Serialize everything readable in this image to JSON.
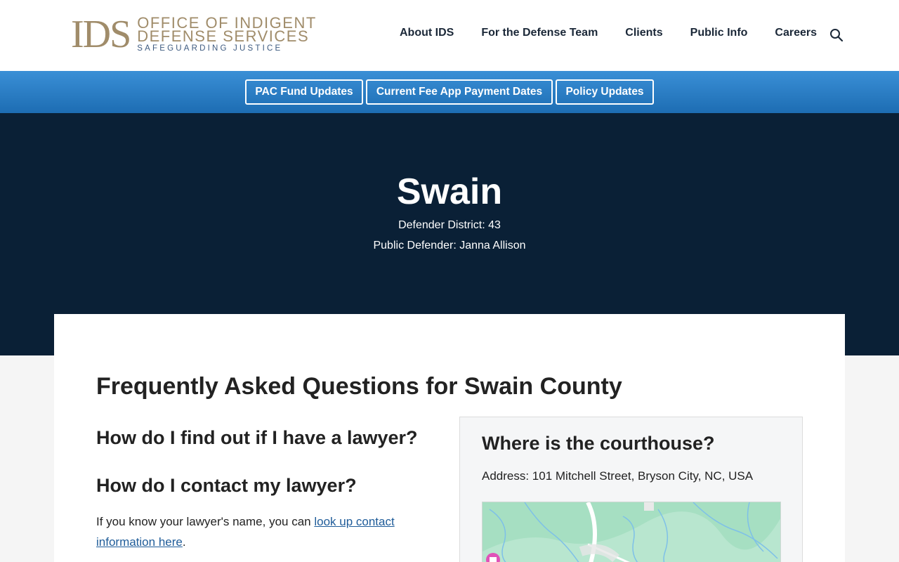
{
  "logo": {
    "mark": "IDS",
    "line1": "OFFICE OF INDIGENT",
    "line2": "DEFENSE SERVICES",
    "tagline": "SAFEGUARDING JUSTICE"
  },
  "nav": {
    "items": [
      "About IDS",
      "For the Defense Team",
      "Clients",
      "Public Info",
      "Careers"
    ],
    "search_icon": "search-icon"
  },
  "quickbar": {
    "buttons": [
      "PAC Fund Updates",
      "Current Fee App Payment Dates",
      "Policy Updates"
    ]
  },
  "hero": {
    "title": "Swain",
    "district": "Defender District: 43",
    "defender": "Public Defender: Janna Allison"
  },
  "faq": {
    "title": "Frequently Asked Questions for Swain County",
    "q1": "How do I find out if I have a lawyer?",
    "q2": "How do I contact my lawyer?",
    "answer_prefix": "If you know your lawyer's name, you can ",
    "answer_link": "look up contact information here",
    "answer_suffix": "."
  },
  "courthouse": {
    "title": "Where is the courthouse?",
    "address": "Address: 101 Mitchell Street, Bryson City, NC, USA"
  },
  "colors": {
    "brand_gold": "#a08c6a",
    "brand_blue": "#3d5a80",
    "hero_bg": "#0a2036",
    "quickbar_top": "#3a8fd6",
    "quickbar_bottom": "#1d6db3",
    "link": "#1f5c99"
  }
}
